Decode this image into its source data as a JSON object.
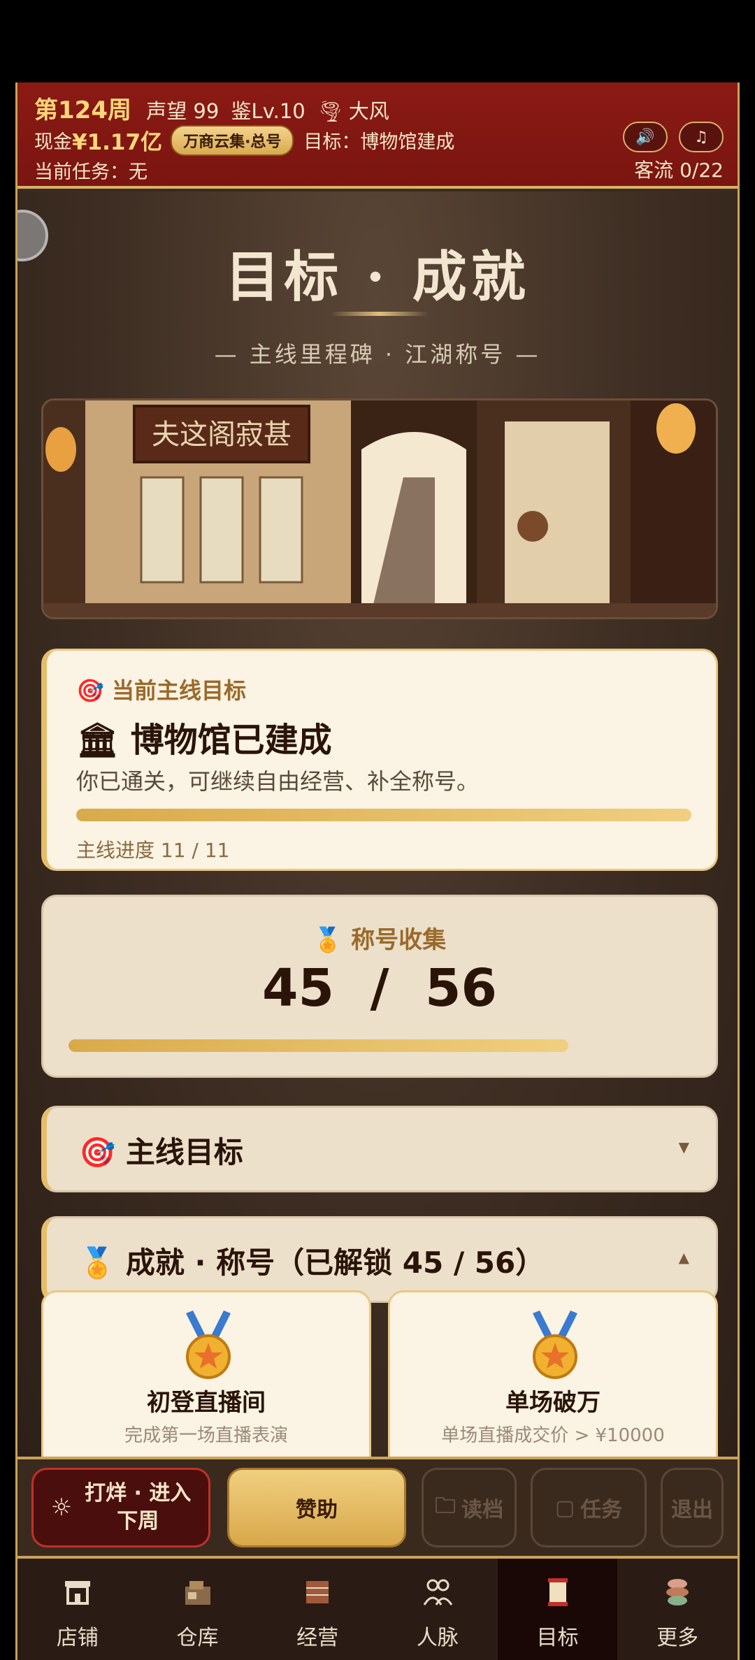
{
  "header": {
    "week": "第124周",
    "reputation": "声望 99",
    "level": "鉴Lv.10",
    "weather_icon": "tornado-icon",
    "weather": "大风",
    "cash_label": "现金",
    "cash_value": "¥1.17亿",
    "badge": "万商云集·总号",
    "goal_text": "目标：博物馆建成",
    "task_text": "当前任务：无",
    "traffic": "客流 0/22",
    "sound_icon": "speaker-icon",
    "music_icon": "music-note-icon"
  },
  "page": {
    "title": "目标 · 成就",
    "subtitle": "— 主线里程碑 · 江湖称号 —",
    "banner_sign": "夫这阁寂甚"
  },
  "main_goal": {
    "label": "当前主线目标",
    "title": "博物馆已建成",
    "description": "你已通关，可继续自由经营、补全称号。",
    "progress_text": "主线进度 11 / 11",
    "progress": 1.0
  },
  "collection": {
    "label": "称号收集",
    "count_text": "45  /  56",
    "progress": 0.8036
  },
  "sections": [
    {
      "title": "主线目标",
      "expanded": false
    },
    {
      "title": "成就 · 称号（已解锁 45 / 56）",
      "expanded": true
    }
  ],
  "achievements": [
    {
      "name": "初登直播间",
      "desc": "完成第一场直播表演"
    },
    {
      "name": "单场破万",
      "desc": "单场直播成交价 > ¥10000"
    }
  ],
  "actions": {
    "end_week": "打烊 · 进入\n下周",
    "sponsor": "赞助",
    "load": "读档",
    "tasks": "任务",
    "exit": "退出"
  },
  "tabs": [
    {
      "label": "店铺",
      "icon": "shop-icon"
    },
    {
      "label": "仓库",
      "icon": "warehouse-icon"
    },
    {
      "label": "经营",
      "icon": "business-icon"
    },
    {
      "label": "人脉",
      "icon": "people-icon"
    },
    {
      "label": "目标",
      "icon": "goal-scroll-icon",
      "active": true
    },
    {
      "label": "更多",
      "icon": "more-icon"
    }
  ],
  "colors": {
    "header_red": "#8b1a14",
    "gold": "#d9aa4a",
    "panel_cream": "#fbf3e3",
    "dark_brown": "#3a2a20"
  }
}
